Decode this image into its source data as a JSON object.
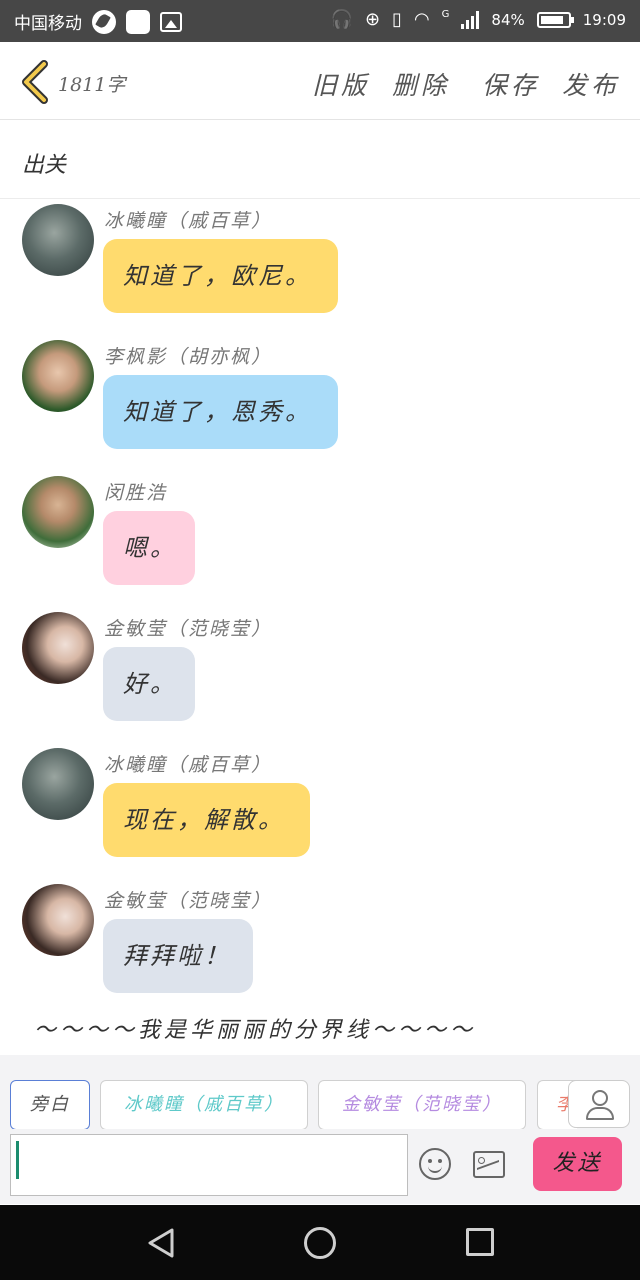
{
  "status_bar": {
    "carrier": "中国移动",
    "battery_percent": "84%",
    "time": "19:09",
    "network_type": "G",
    "icons": [
      "headphones-icon",
      "data-saver-icon",
      "vibrate-icon",
      "wifi-icon",
      "signal-icon",
      "battery-icon"
    ]
  },
  "header": {
    "word_count": "1811字",
    "actions": {
      "old_version": "旧版",
      "delete": "删除",
      "save": "保存",
      "publish": "发布"
    },
    "accent_color": "#f2c94c"
  },
  "chapter": {
    "title": "出关"
  },
  "messages": [
    {
      "sender": "冰曦瞳（戚百草）",
      "text": "知道了，欧尼。",
      "bubble_color": "#ffdb6e"
    },
    {
      "sender": "李枫影（胡亦枫）",
      "text": "知道了，恩秀。",
      "bubble_color": "#aadcf9"
    },
    {
      "sender": "闵胜浩",
      "text": "嗯。",
      "bubble_color": "#ffd0df"
    },
    {
      "sender": "金敏莹（范晓莹）",
      "text": "好。",
      "bubble_color": "#dde3ec"
    },
    {
      "sender": "冰曦瞳（戚百草）",
      "text": "现在，解散。",
      "bubble_color": "#ffdb6e"
    },
    {
      "sender": "金敏莹（范晓莹）",
      "text": "拜拜啦！",
      "bubble_color": "#dde3ec"
    }
  ],
  "divider_text": "～～～～我是华丽丽的分界线～～～～",
  "roles": [
    {
      "label": "旁白",
      "color": "#555555",
      "selected": true
    },
    {
      "label": "冰曦瞳（戚百草）",
      "color": "#5ec9c9",
      "selected": false
    },
    {
      "label": "金敏莹（范晓莹）",
      "color": "#b58be0",
      "selected": false
    },
    {
      "label": "李",
      "color": "#e97a6a",
      "selected": false
    }
  ],
  "composer": {
    "value": "",
    "send_label": "发送",
    "send_color": "#f4588c"
  }
}
